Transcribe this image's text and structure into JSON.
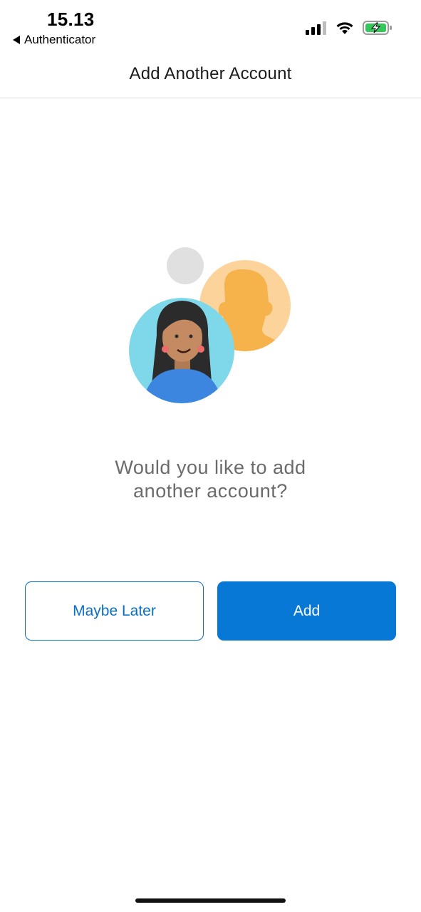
{
  "status_bar": {
    "time": "15.13",
    "back_app": "Authenticator",
    "icons": [
      "signal-icon",
      "wifi-icon",
      "battery-charging-icon"
    ]
  },
  "nav": {
    "title": "Add Another Account"
  },
  "prompt": {
    "line1": "Would you like to add",
    "line2": "another account?"
  },
  "buttons": {
    "later": "Maybe Later",
    "add": "Add"
  },
  "colors": {
    "accent": "#0778d6",
    "prompt_text": "#6b6b6b",
    "battery_green": "#34c759"
  }
}
